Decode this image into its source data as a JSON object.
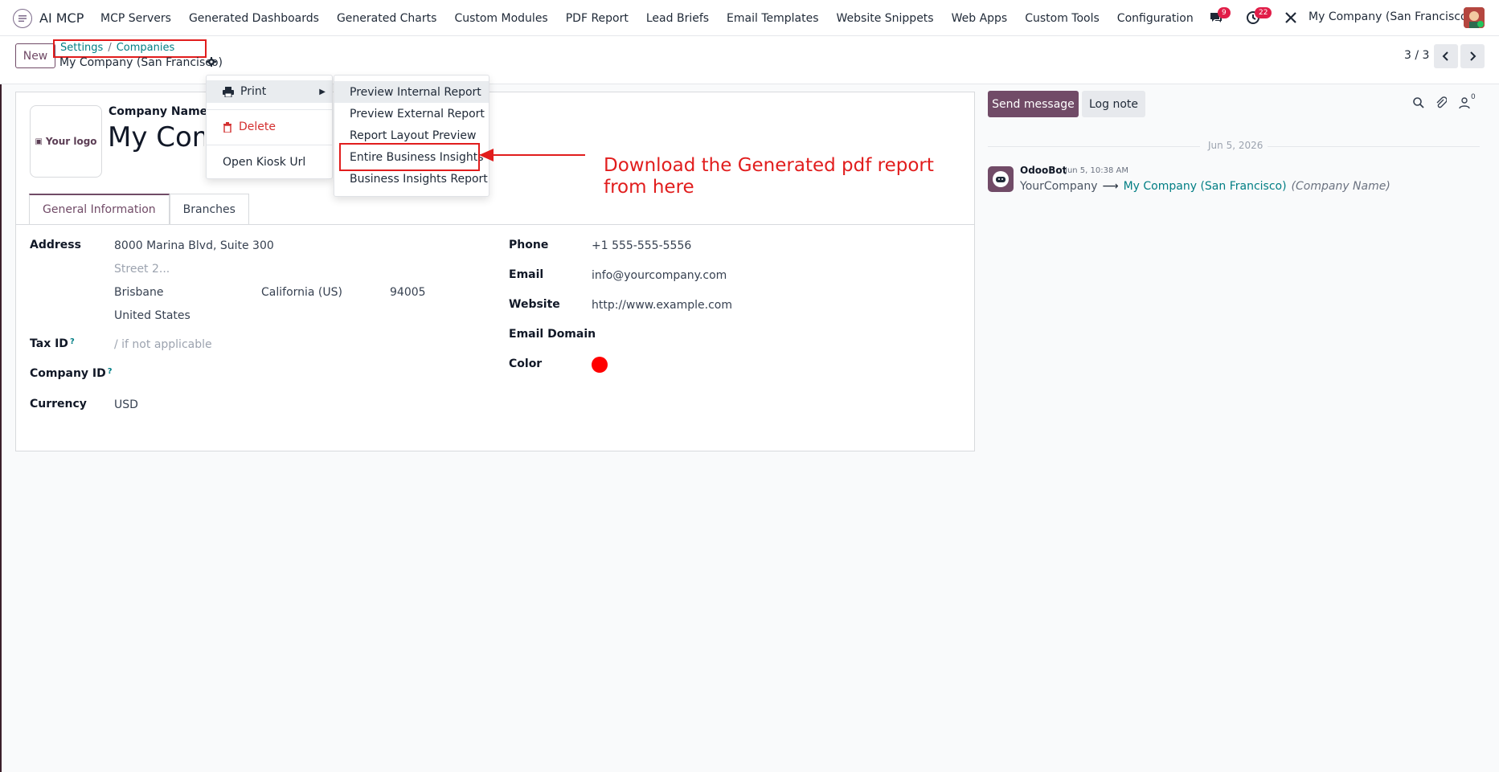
{
  "app": {
    "name": "AI MCP"
  },
  "navbar": {
    "menu": [
      "MCP Servers",
      "Generated Dashboards",
      "Generated Charts",
      "Custom Modules",
      "PDF Report",
      "Lead Briefs",
      "Email Templates",
      "Website Snippets",
      "Web Apps",
      "Custom Tools",
      "Configuration"
    ],
    "messages_count": "9",
    "activities_count": "22",
    "company": "My Company (San Francisco)"
  },
  "control": {
    "new_label": "New",
    "breadcrumb": {
      "parent": "Settings",
      "sep": "/",
      "current": "Companies"
    },
    "record_name": "My Company (San Francisco)",
    "pager": "3 / 3"
  },
  "form": {
    "logo_text": "Your logo",
    "company_name_label": "Company Name",
    "company_name_value": "My Company (San Francisco)",
    "tabs": [
      "General Information",
      "Branches"
    ],
    "address_label": "Address",
    "street": "8000 Marina Blvd, Suite 300",
    "street2_placeholder": "Street 2...",
    "city": "Brisbane",
    "state": "California (US)",
    "zip": "94005",
    "country": "United States",
    "tax_label": "Tax ID",
    "tax_placeholder": "/ if not applicable",
    "company_id_label": "Company ID",
    "help_mark": "?",
    "currency_label": "Currency",
    "currency": "USD",
    "phone_label": "Phone",
    "phone": "+1 555-555-5556",
    "email_label": "Email",
    "email": "info@yourcompany.com",
    "website_label": "Website",
    "website": "http://www.example.com",
    "email_domain_label": "Email Domain",
    "color_label": "Color",
    "color_value": "#ff0000"
  },
  "actions_menu": {
    "print": "Print",
    "delete": "Delete",
    "kiosk": "Open Kiosk Url",
    "print_items": [
      "Preview Internal Report",
      "Preview External Report",
      "Report Layout Preview",
      "Entire Business Insights",
      "Business Insights Report"
    ]
  },
  "annotation": {
    "text": "Download the Generated pdf report from here"
  },
  "chatter": {
    "send_message": "Send message",
    "log_note": "Log note",
    "followers_count": "0",
    "date": "Jun 5, 2026",
    "author": "OdooBot",
    "time": "Jun 5, 10:38 AM",
    "old_value": "YourCompany",
    "new_value": "My Company (San Francisco)",
    "field": "(Company Name)"
  },
  "colors": {
    "brand": "#714b67",
    "link": "#017e84",
    "annotation": "#e11d1d",
    "badge": "#e11d48"
  }
}
